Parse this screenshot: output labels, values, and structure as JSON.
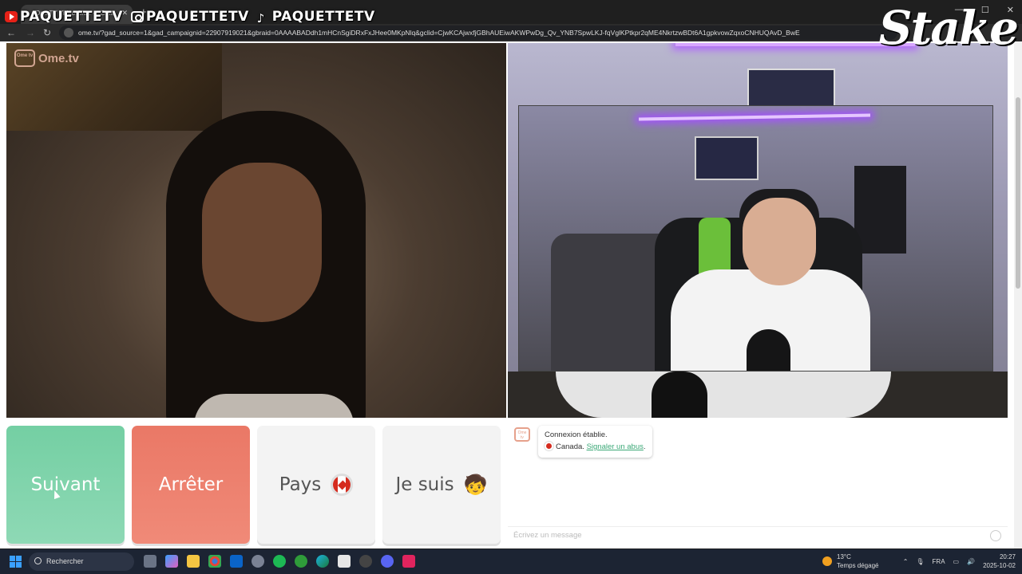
{
  "browser": {
    "tab_title": "OmeTV Video Chat — Ome",
    "url": "ome.tv/?gad_source=1&gad_campaignid=22907919021&gbraid=0AAAABADdh1mHCnSgiDRxFxJHee0MKpNlq&gclid=CjwKCAjwxfjGBhAUEiwAKWPwDg_Qv_YNB7SpwLKJ-fqVglKPtkpr2qME4NkrtzwBDt6A1gpkvowZqxoCNHUQAvD_BwE"
  },
  "overlay": {
    "youtube_handle": "PAQUETTETV",
    "instagram_handle": "PAQUETTETV",
    "tiktok_handle": "PAQUETTETV",
    "sponsor": "Stake"
  },
  "site": {
    "logo_text": "Ome.tv",
    "logo_box": "Ome tv"
  },
  "controls": {
    "next_label": "Suivant",
    "stop_label": "Arrêter",
    "country_label": "Pays",
    "gender_label": "Je suis",
    "gender_emoji": "🧒"
  },
  "chat": {
    "status_line": "Connexion établie.",
    "country": "Canada.",
    "report_link": "Signaler un abus",
    "report_suffix": ".",
    "input_placeholder": "Écrivez un message"
  },
  "taskbar": {
    "search_label": "Rechercher",
    "weather_temp": "13°C",
    "weather_desc": "Temps dégagé",
    "language": "FRA",
    "time": "20:27",
    "date": "2025-10-02"
  },
  "colors": {
    "next_button": "#74cfa3",
    "stop_button": "#ea7866",
    "link": "#3aa876"
  }
}
